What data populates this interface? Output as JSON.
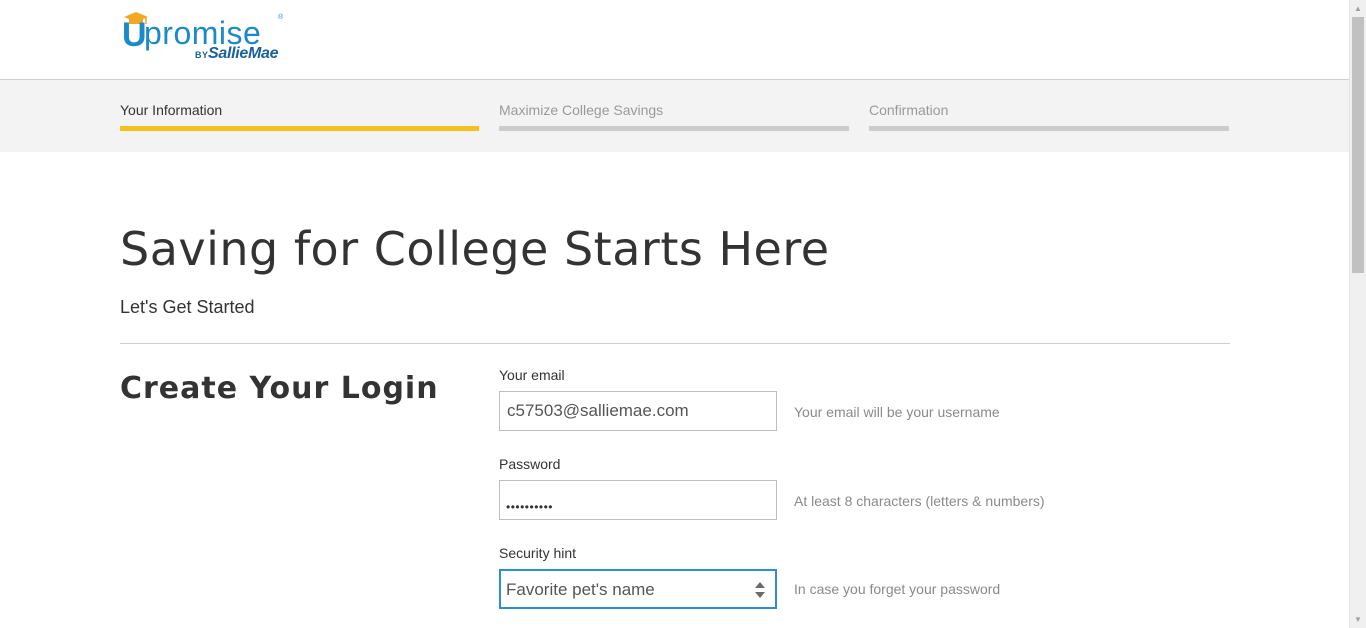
{
  "brand": {
    "logo_u": "U",
    "logo_word": "promise",
    "logo_tm": "®",
    "logo_by": "BY",
    "logo_sallie": "SallieMae",
    "colors": {
      "brand_blue": "#1b8ac9",
      "sallie_blue": "#1b5fa3",
      "cap_gold": "#f5a623"
    }
  },
  "steps": [
    {
      "label": "Your Information",
      "state": "active"
    },
    {
      "label": "Maximize College Savings",
      "state": "inactive"
    },
    {
      "label": "Confirmation",
      "state": "inactive"
    }
  ],
  "steps_colors": {
    "active": "#f5c11e",
    "inactive": "#cccccc"
  },
  "main": {
    "title": "Saving for College Starts Here",
    "subtitle": "Let's Get Started"
  },
  "login": {
    "section_title": "Create Your Login",
    "email": {
      "label": "Your email",
      "value": "c57503@salliemae.com",
      "hint": "Your email will be your username"
    },
    "password": {
      "label": "Password",
      "masked_value": "••••••••••",
      "hint": "At least 8 characters (letters & numbers)"
    },
    "security_hint": {
      "label": "Security hint",
      "selected": "Favorite pet's name",
      "hint": "In case you forget your password"
    }
  },
  "icons": {
    "cap": "graduation-cap-icon",
    "select_arrows": "select-arrows-icon",
    "scroll_up": "scroll-up-arrow-icon",
    "scroll_down": "scroll-down-arrow-icon"
  }
}
